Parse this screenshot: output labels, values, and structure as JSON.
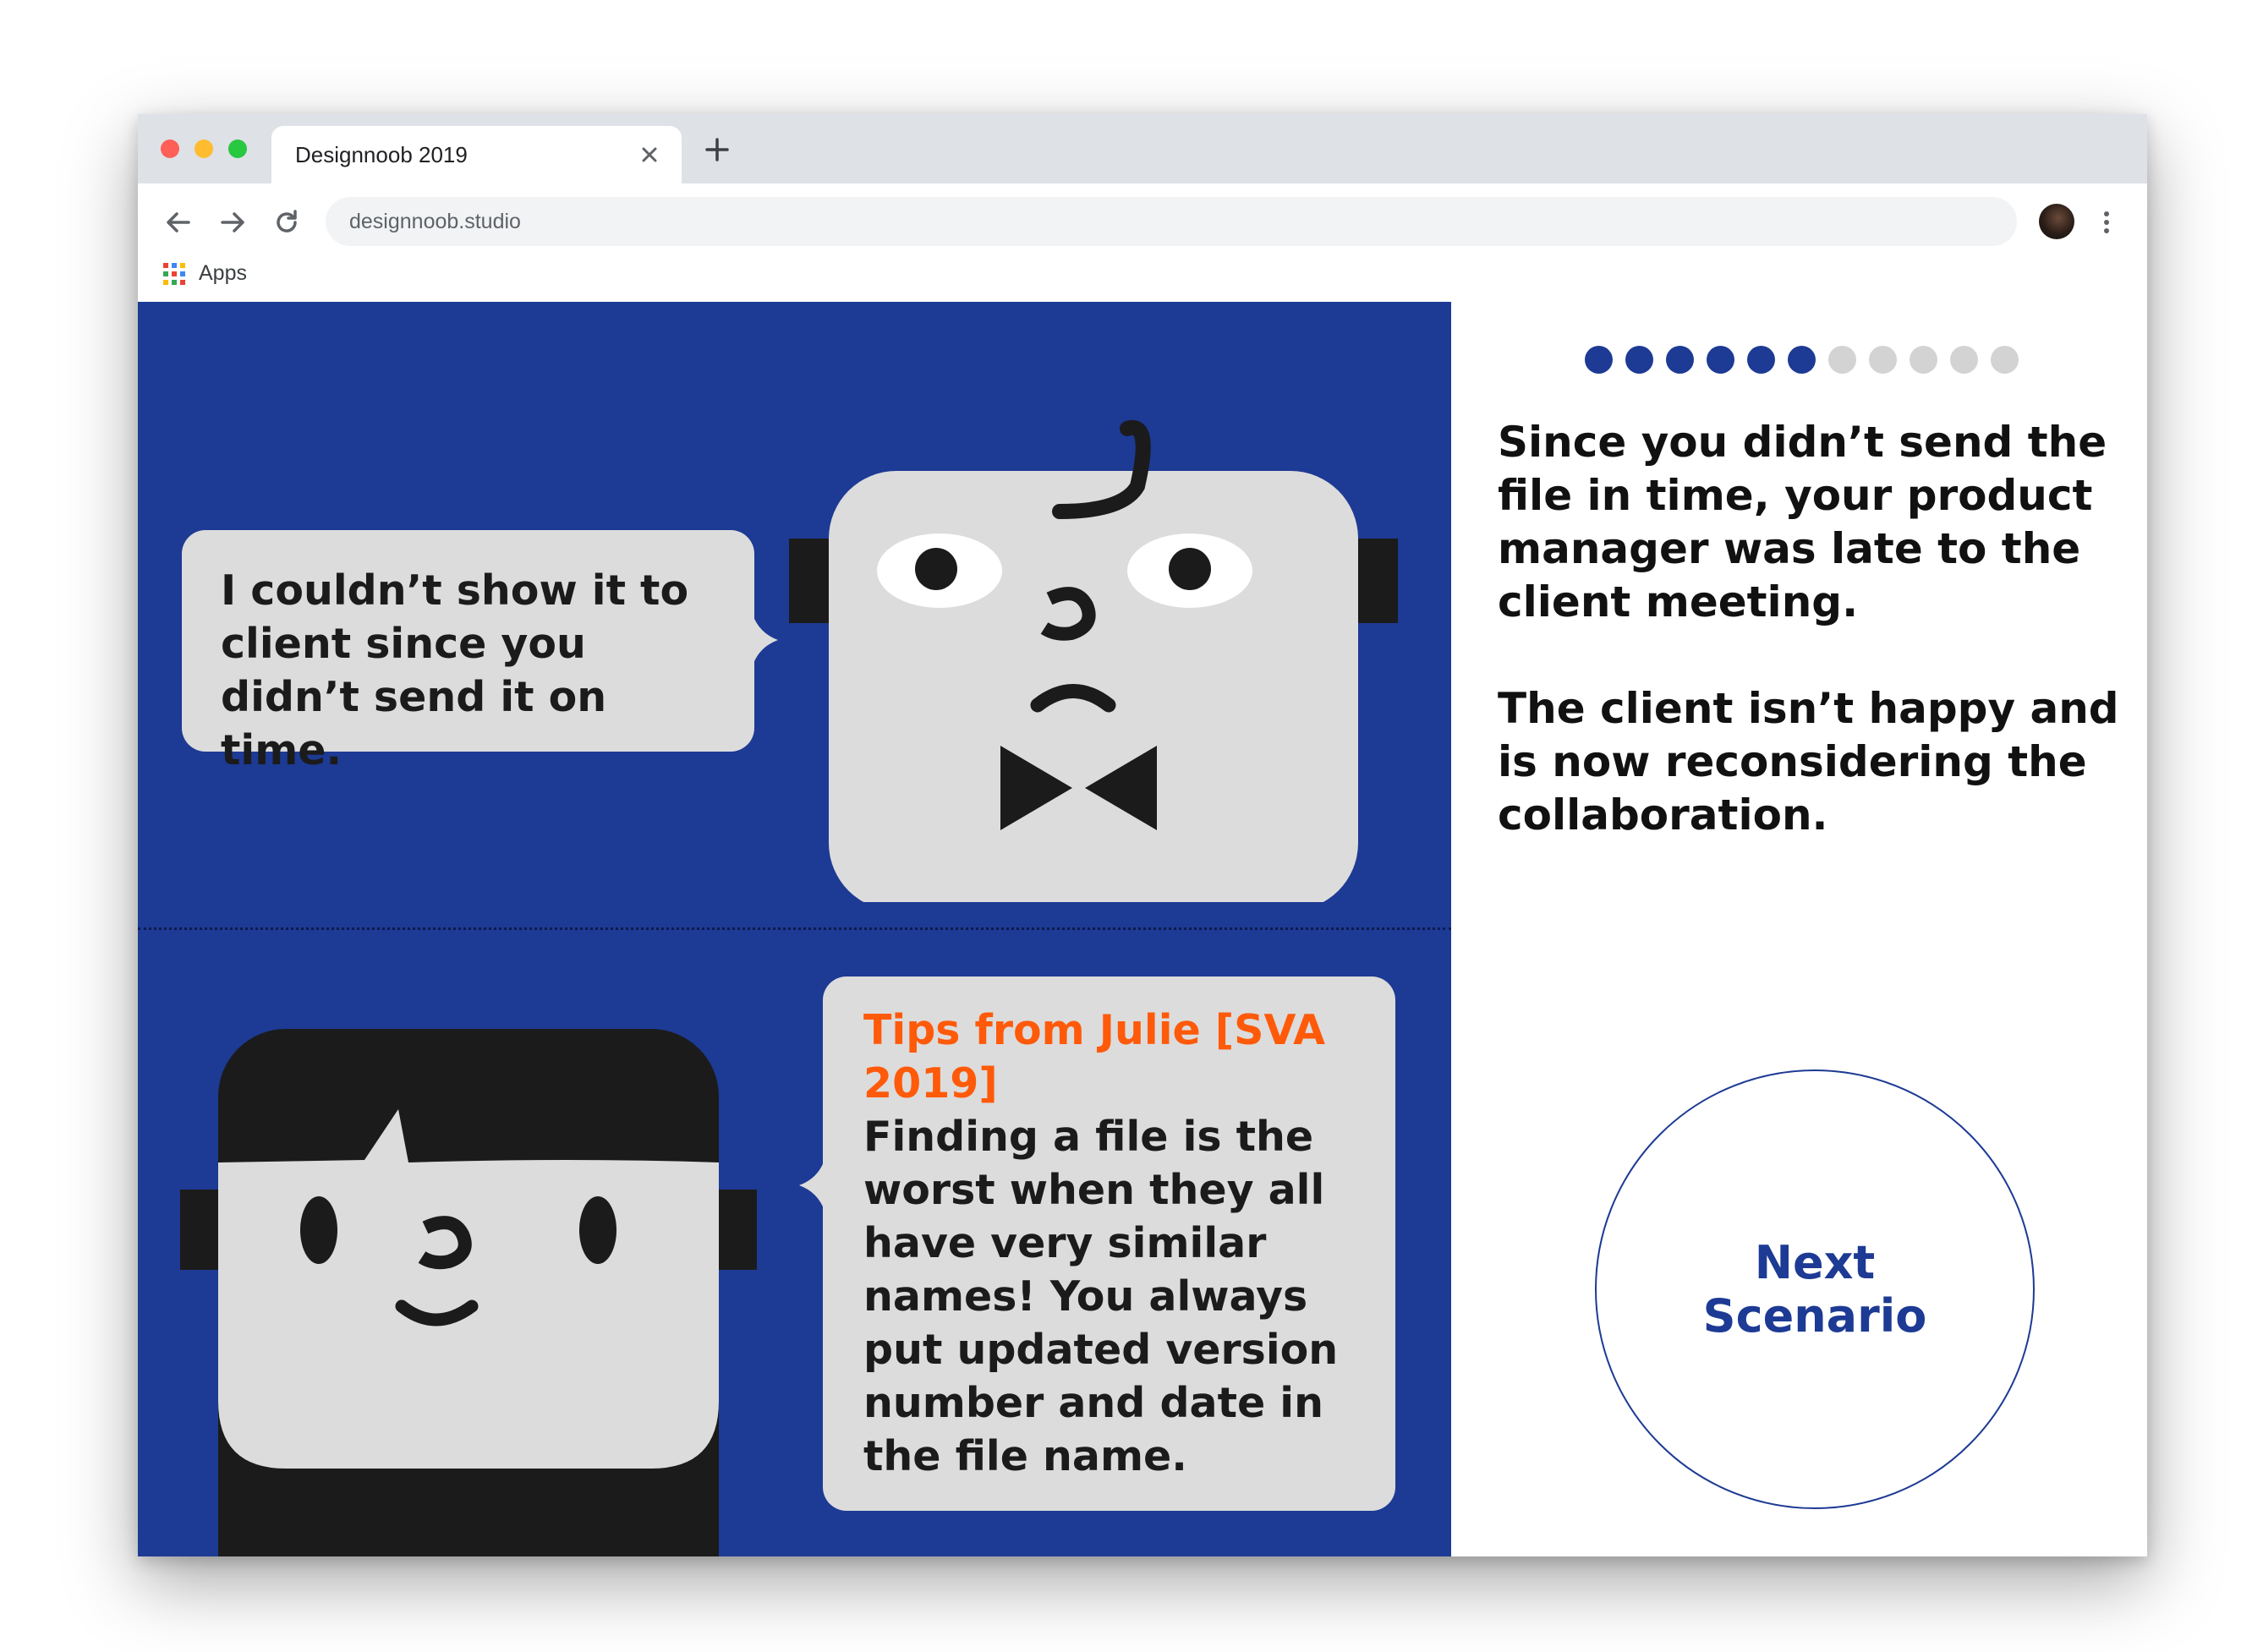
{
  "browser": {
    "tab_title": "Designnoob 2019",
    "tab_close_icon": "close-icon",
    "new_tab_icon": "plus-icon",
    "address": "designnoob.studio",
    "bookmarks": {
      "apps_label": "Apps"
    }
  },
  "comic": {
    "speech_1": "I couldn’t show it to client since you didn’t send it on time.",
    "tip_heading": "Tips from Julie [SVA 2019]",
    "tip_body": "Finding a file is the worst when they all have very similar names! You always put updated version number and date in the file name.",
    "colors": {
      "background": "#1d3a94",
      "bubble": "#dcdcdc",
      "accent": "#ff5a0a"
    }
  },
  "panel": {
    "progress": {
      "total": 11,
      "completed": 6,
      "active_color": "#1d3a94",
      "inactive_color": "#d3d3d3"
    },
    "story_paragraphs": [
      "Since you didn’t send the file in time, your product manager was late to the client meeting.",
      "The client isn’t happy and is now reconsidering the collaboration."
    ],
    "next_button_label": "Next Scenario"
  }
}
